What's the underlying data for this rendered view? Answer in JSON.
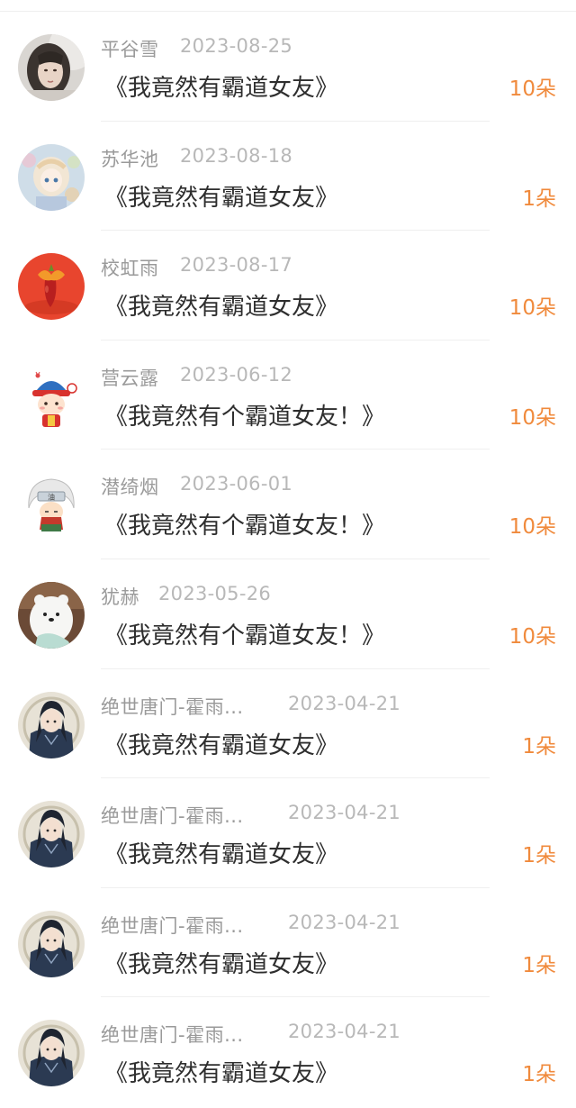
{
  "gifts": [
    {
      "user": "平谷雪",
      "date": "2023-08-25",
      "book": "《我竟然有霸道女友》",
      "amount": "10朵",
      "avatar": "girl-photo-avatar"
    },
    {
      "user": "苏华池",
      "date": "2023-08-18",
      "book": "《我竟然有霸道女友》",
      "amount": "1朵",
      "avatar": "anime-girl-avatar"
    },
    {
      "user": "校虹雨",
      "date": "2023-08-17",
      "book": "《我竟然有霸道女友》",
      "amount": "10朵",
      "avatar": "red-fruit-avatar"
    },
    {
      "user": "营云露",
      "date": "2023-06-12",
      "book": "《我竟然有个霸道女友！》",
      "amount": "10朵",
      "avatar": "cartoon-boy-avatar"
    },
    {
      "user": "潜绮烟",
      "date": "2023-06-01",
      "book": "《我竟然有个霸道女友！》",
      "amount": "10朵",
      "avatar": "cartoon-sage-avatar"
    },
    {
      "user": "犹赫",
      "date": "2023-05-26",
      "book": "《我竟然有个霸道女友！》",
      "amount": "10朵",
      "avatar": "white-bear-avatar"
    },
    {
      "user": "绝世唐门-霍雨...",
      "date": "2023-04-21",
      "book": "《我竟然有霸道女友》",
      "amount": "1朵",
      "avatar": "anime-warrior-avatar"
    },
    {
      "user": "绝世唐门-霍雨...",
      "date": "2023-04-21",
      "book": "《我竟然有霸道女友》",
      "amount": "1朵",
      "avatar": "anime-warrior-avatar"
    },
    {
      "user": "绝世唐门-霍雨...",
      "date": "2023-04-21",
      "book": "《我竟然有霸道女友》",
      "amount": "1朵",
      "avatar": "anime-warrior-avatar"
    },
    {
      "user": "绝世唐门-霍雨...",
      "date": "2023-04-21",
      "book": "《我竟然有霸道女友》",
      "amount": "1朵",
      "avatar": "anime-warrior-avatar"
    }
  ],
  "colors": {
    "accent": "#f08a3c",
    "username": "#9a9a9a",
    "date": "#b8b8b8",
    "title": "#2e2e2e"
  }
}
